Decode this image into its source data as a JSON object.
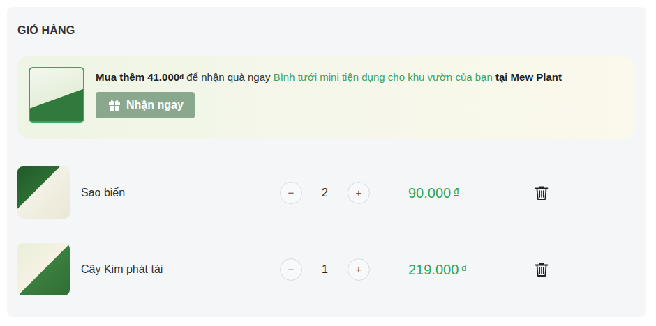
{
  "cart": {
    "title": "GIỎ HÀNG"
  },
  "promo": {
    "prefix": "Mua thêm",
    "amount": "41.000",
    "currency": "đ",
    "middle": "để nhận quà ngay",
    "gift": "Bình tưới mini tiện dụng cho khu vườn của bạn",
    "suffix": "tại Mew Plant",
    "button": "Nhận ngay"
  },
  "items": [
    {
      "name": "Sao biến",
      "decrease": "−",
      "quantity": "2",
      "increase": "+",
      "price": "90.000",
      "currency": "đ"
    },
    {
      "name": "Cây Kim phát tài",
      "decrease": "−",
      "quantity": "1",
      "increase": "+",
      "price": "219.000",
      "currency": "đ"
    }
  ]
}
